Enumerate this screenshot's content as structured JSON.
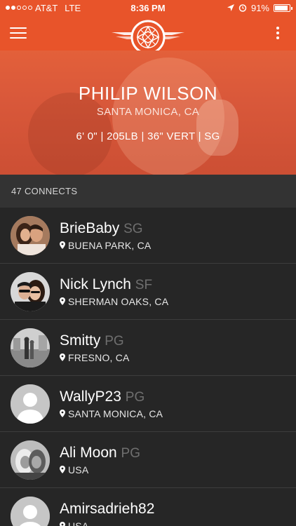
{
  "status_bar": {
    "carrier": "AT&T",
    "network": "LTE",
    "time": "8:36 PM",
    "battery": "91%",
    "battery_level": 0.91,
    "signal_bars_filled": 2,
    "signal_bars_total": 5
  },
  "top_bar": {
    "menu_icon": "hamburger-menu-icon",
    "logo_icon": "basketball-wings-logo",
    "more_icon": "more-vertical-icon",
    "accent_color": "#e8542a"
  },
  "profile": {
    "name": "PHILIP WILSON",
    "location": "SANTA MONICA, CA",
    "stats": "6' 0\" | 205LB | 36\" VERT | SG"
  },
  "connects": {
    "label": "47 CONNECTS"
  },
  "list": [
    {
      "name": "BrieBaby",
      "position": "SG",
      "location": "BUENA PARK, CA",
      "avatar": "photo-couple"
    },
    {
      "name": "Nick Lynch",
      "position": "SF",
      "location": "SHERMAN OAKS, CA",
      "avatar": "photo-couple-sunglasses"
    },
    {
      "name": "Smitty",
      "position": "PG",
      "location": "FRESNO, CA",
      "avatar": "photo-grayscale-street"
    },
    {
      "name": "WallyP23",
      "position": "PG",
      "location": "SANTA MONICA, CA",
      "avatar": "default-avatar"
    },
    {
      "name": "Ali Moon",
      "position": "PG",
      "location": "USA",
      "avatar": "photo-grayscale-women"
    },
    {
      "name": "Amirsadrieh82",
      "position": "",
      "location": "USA",
      "avatar": "default-avatar"
    }
  ]
}
